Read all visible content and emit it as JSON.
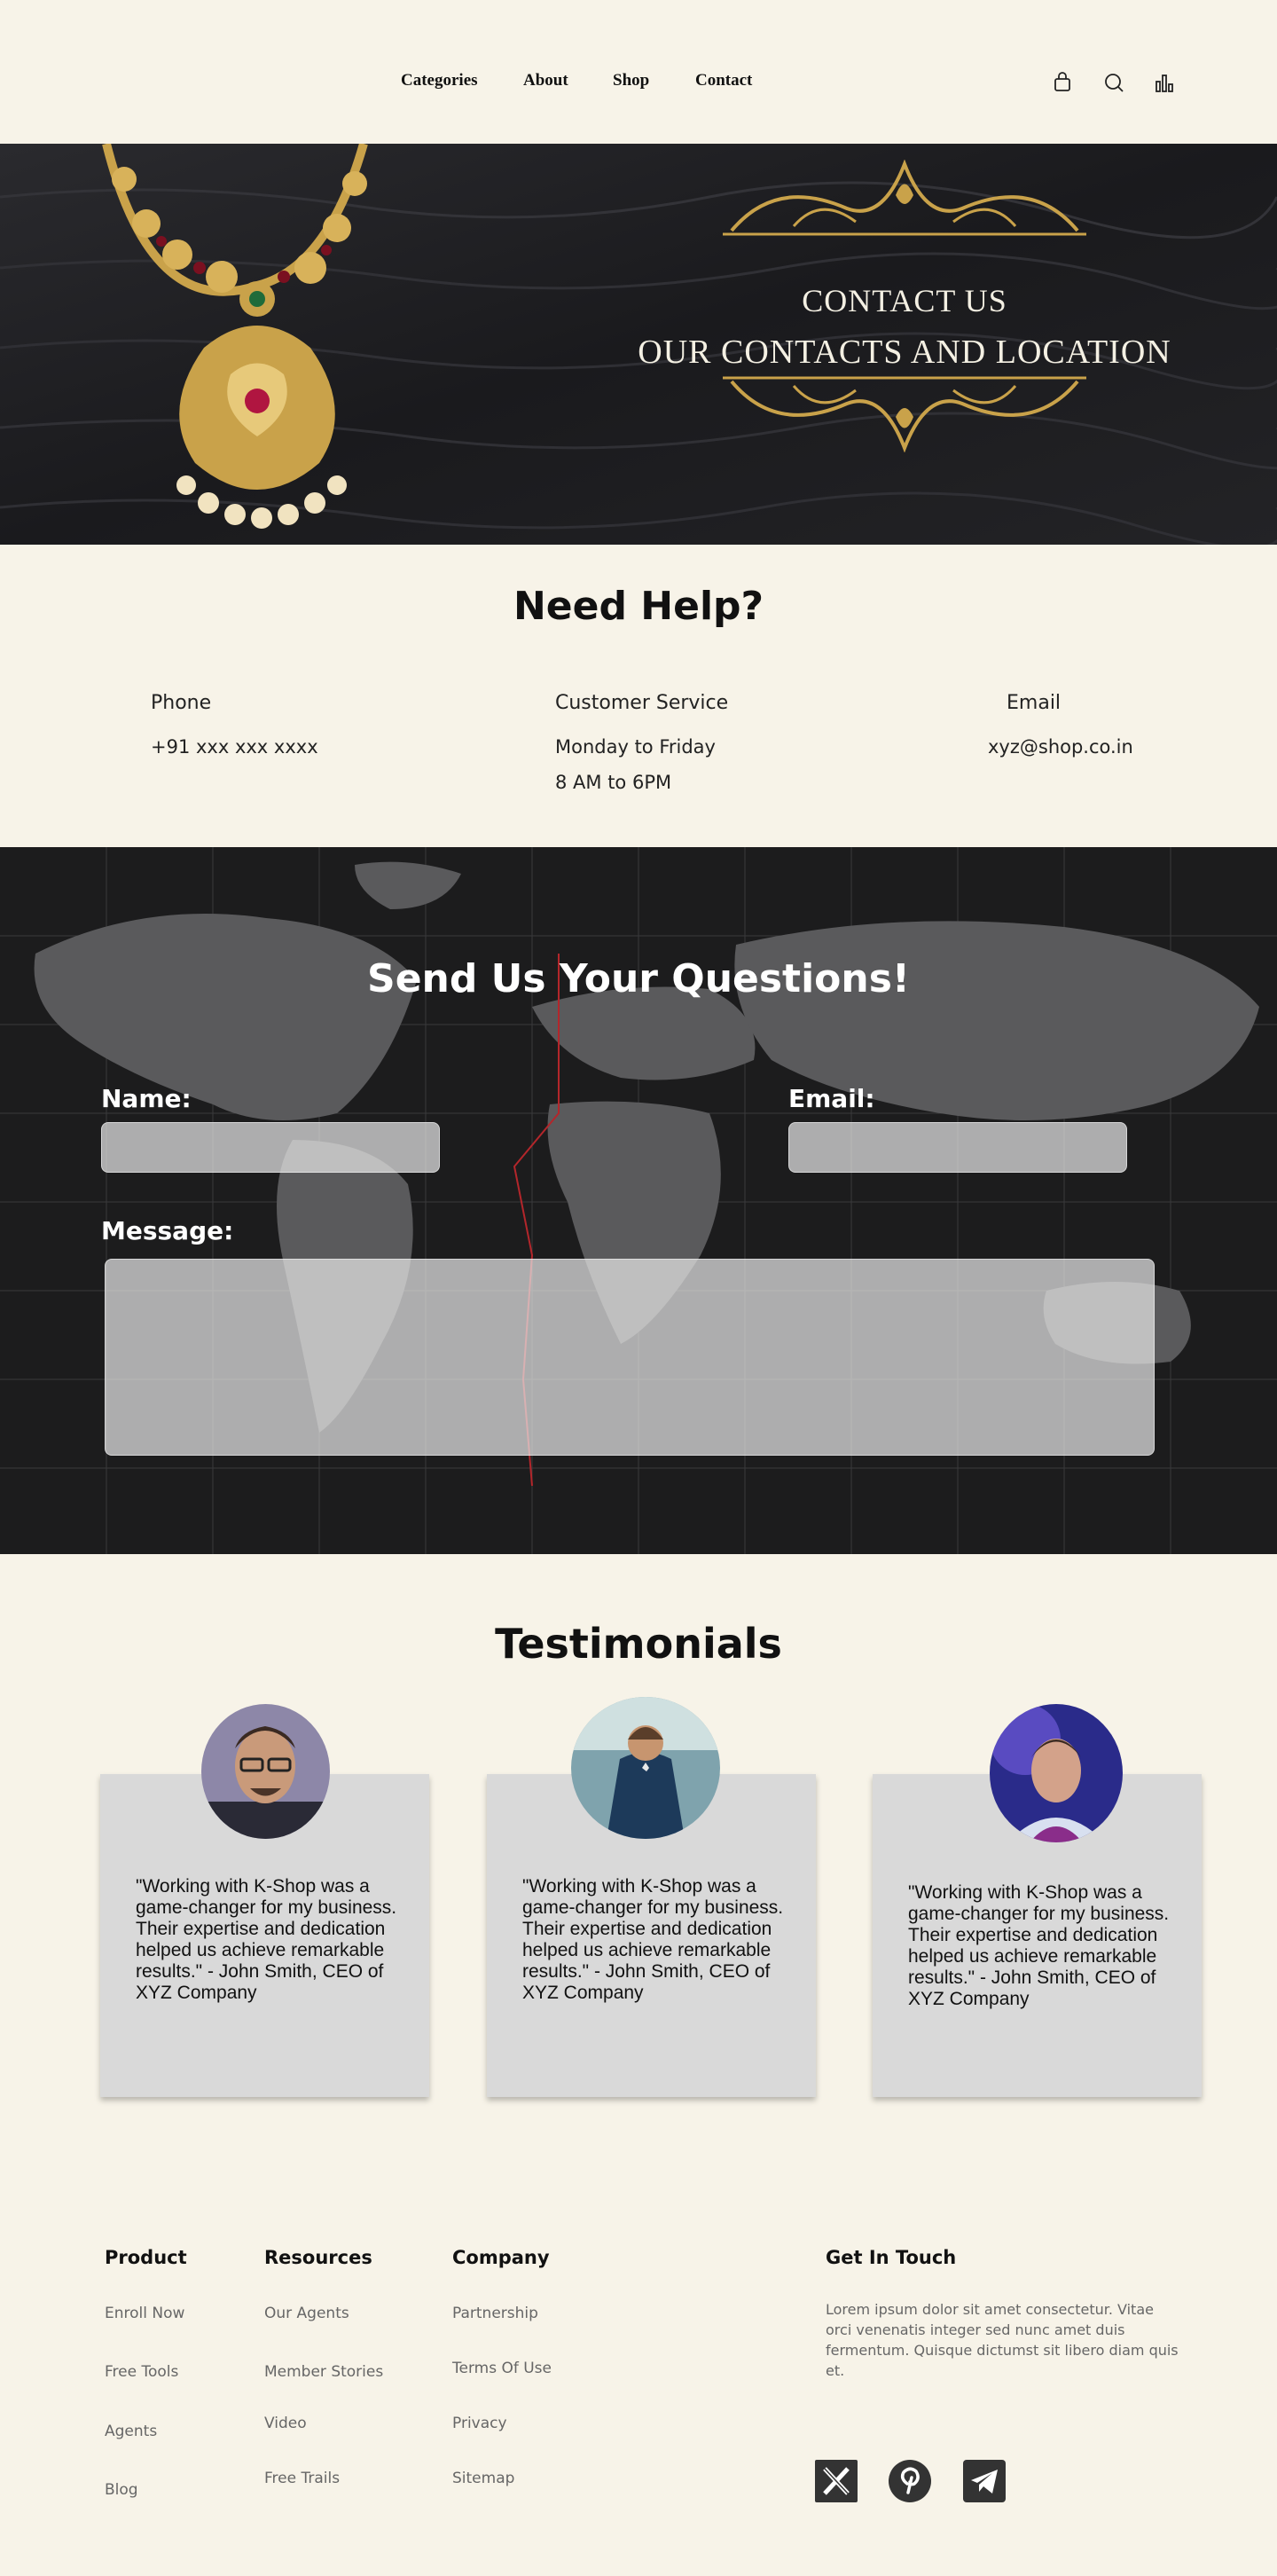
{
  "nav": {
    "items": [
      {
        "label": "Categories"
      },
      {
        "label": "About"
      },
      {
        "label": "Shop"
      },
      {
        "label": "Contact"
      }
    ],
    "icons": [
      "bag-icon",
      "search-icon",
      "chart-icon"
    ]
  },
  "hero": {
    "line1": "CONTACT US",
    "line2": "OUR CONTACTS AND LOCATION"
  },
  "help": {
    "title": "Need Help?",
    "phone_label": "Phone",
    "phone_value": "+91 xxx xxx xxxx",
    "service_label": "Customer Service",
    "service_days": "Monday  to Friday",
    "service_hours": "8 AM to 6PM",
    "email_label": "Email",
    "email_value": "xyz@shop.co.in"
  },
  "questions": {
    "title": "Send Us Your Questions!",
    "name_label": "Name:",
    "email_label": "Email:",
    "message_label": "Message:",
    "name_placeholder": "",
    "email_placeholder": "",
    "message_placeholder": ""
  },
  "testimonials": {
    "title": "Testimonials",
    "cards": [
      {
        "quote": "\"Working with K-Shop was a game-changer for my business. Their expertise and dedication helped us achieve remarkable results.\" - John Smith, CEO of XYZ Company"
      },
      {
        "quote": "\"Working with K-Shop was a game-changer for my business. Their expertise and dedication helped us achieve remarkable results.\" - John Smith, CEO of XYZ Company"
      },
      {
        "quote": "\"Working with K-Shop was a game-changer for my business. Their expertise and dedication helped us achieve remarkable results.\" - John Smith, CEO of XYZ Company"
      }
    ]
  },
  "footer": {
    "product": {
      "heading": "Product",
      "links": [
        "Enroll Now",
        "Free Tools",
        "Agents",
        "Blog"
      ]
    },
    "resources": {
      "heading": "Resources",
      "links": [
        "Our Agents",
        "Member Stories",
        "Video",
        "Free Trails"
      ]
    },
    "company": {
      "heading": "Company",
      "links": [
        "Partnership",
        "Terms Of Use",
        "Privacy",
        "Sitemap"
      ]
    },
    "contact": {
      "heading": "Get In Touch",
      "description": "Lorem ipsum dolor sit amet consectetur. Vitae orci venenatis integer sed nunc amet duis fermentum. Quisque dictumst sit libero diam quis et."
    },
    "social_icons": [
      "x-icon",
      "pinterest-icon",
      "telegram-icon"
    ]
  },
  "colors": {
    "page_bg": "#f7f3e8",
    "gold": "#c9a24a",
    "card_bg": "#d9d9d9"
  }
}
